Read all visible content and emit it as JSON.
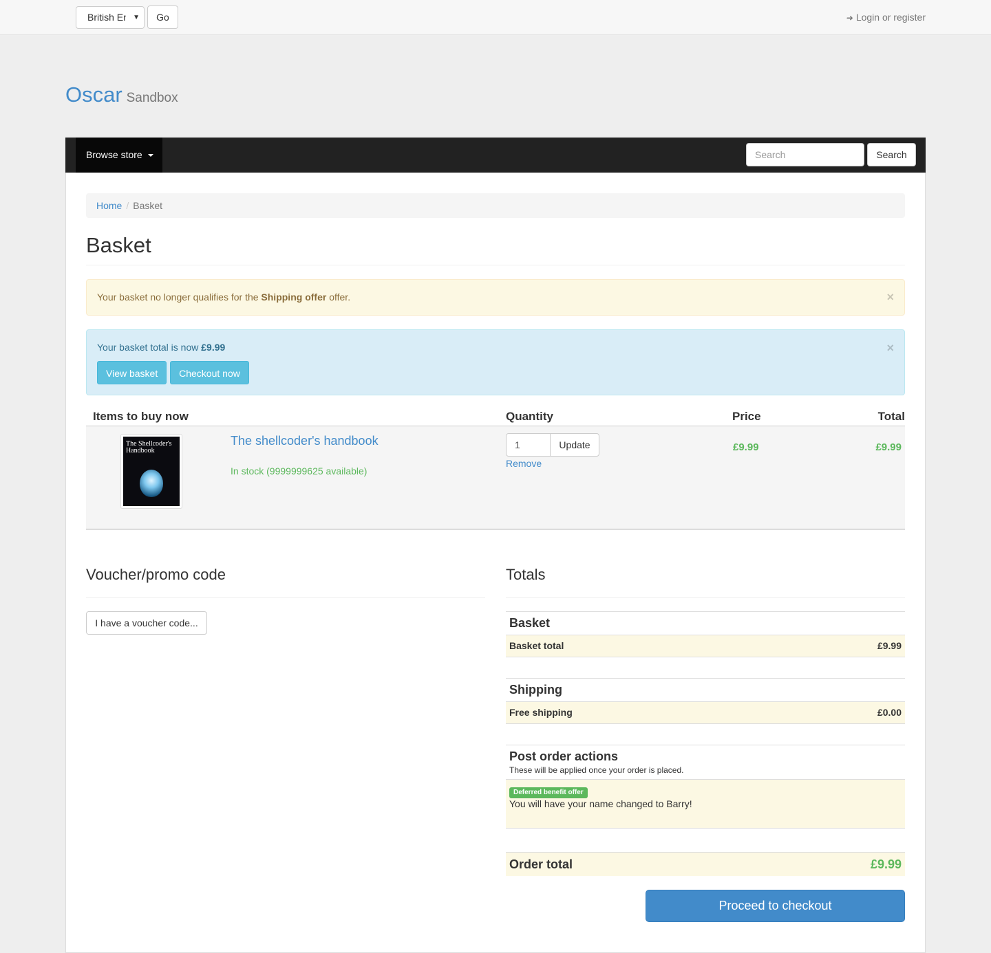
{
  "topbar": {
    "language_selected": "British English",
    "go_label": "Go",
    "login_label": "Login or register"
  },
  "brand": {
    "name": "Oscar",
    "tagline": "Sandbox"
  },
  "navbar": {
    "browse_label": "Browse store",
    "search_placeholder": "Search",
    "search_button": "Search"
  },
  "breadcrumb": {
    "home": "Home",
    "current": "Basket"
  },
  "page": {
    "title": "Basket"
  },
  "alerts": {
    "warning_prefix": "Your basket no longer qualifies for the ",
    "warning_offer": "Shipping offer",
    "warning_suffix": " offer.",
    "info_prefix": "Your basket total is now ",
    "info_total": "£9.99",
    "view_basket": "View basket",
    "checkout_now": "Checkout now",
    "close": "×"
  },
  "basket_table": {
    "headers": {
      "items": "Items to buy now",
      "quantity": "Quantity",
      "price": "Price",
      "total": "Total"
    },
    "line": {
      "title": "The shellcoder's handbook",
      "cover_text": "The Shellcoder's Handbook",
      "stock": "In stock (9999999625 available)",
      "quantity": "1",
      "update": "Update",
      "remove": "Remove",
      "price": "£9.99",
      "total": "£9.99"
    }
  },
  "voucher": {
    "heading": "Voucher/promo code",
    "button": "I have a voucher code..."
  },
  "totals": {
    "heading": "Totals",
    "basket_heading": "Basket",
    "basket_total_label": "Basket total",
    "basket_total": "£9.99",
    "shipping_heading": "Shipping",
    "shipping_label": "Free shipping",
    "shipping_amount": "£0.00",
    "post_heading": "Post order actions",
    "post_note": "These will be applied once your order is placed.",
    "post_badge": "Deferred benefit offer",
    "post_message": "You will have your name changed to Barry!",
    "order_total_label": "Order total",
    "order_total": "£9.99",
    "proceed": "Proceed to checkout"
  },
  "colors": {
    "brand": "#428bca",
    "success": "#5cb85c",
    "navbar": "#222222",
    "warning_bg": "#fcf8e3",
    "info_bg": "#d9edf7"
  }
}
